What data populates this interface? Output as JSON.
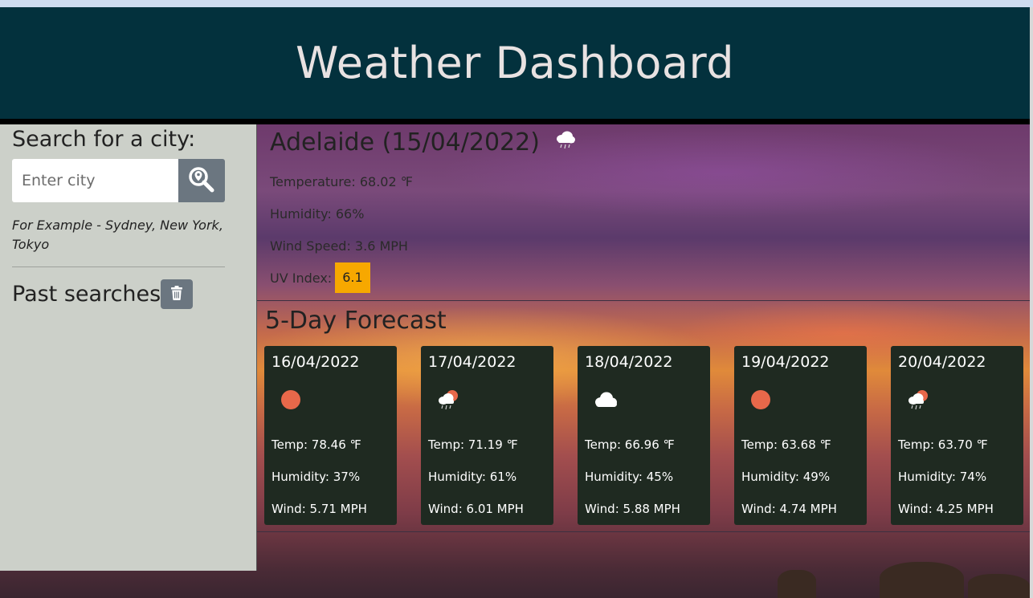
{
  "app": {
    "title": "Weather Dashboard"
  },
  "sidebar": {
    "search_title": "Search for a city:",
    "search_placeholder": "Enter city",
    "example_text": "For Example - Sydney, New York, Tokyo",
    "past_searches_title": "Past searches"
  },
  "current": {
    "title": "Adelaide (15/04/2022)",
    "icon": "rain-cloud-icon",
    "temperature": "Temperature: 68.02 ℉",
    "humidity": "Humidity: 66%",
    "wind": "Wind Speed: 3.6 MPH",
    "uv_label": "UV Index:",
    "uv_value": "6.1",
    "uv_color": "#f7a800"
  },
  "forecast": {
    "title": "5-Day Forecast",
    "days": [
      {
        "date": "16/04/2022",
        "icon": "sun-icon",
        "temp": "Temp: 78.46 ℉",
        "humidity": "Humidity: 37%",
        "wind": "Wind: 5.71 MPH"
      },
      {
        "date": "17/04/2022",
        "icon": "sun-rain-cloud-icon",
        "temp": "Temp: 71.19 ℉",
        "humidity": "Humidity: 61%",
        "wind": "Wind: 6.01 MPH"
      },
      {
        "date": "18/04/2022",
        "icon": "cloud-icon",
        "temp": "Temp: 66.96 ℉",
        "humidity": "Humidity: 45%",
        "wind": "Wind: 5.88 MPH"
      },
      {
        "date": "19/04/2022",
        "icon": "sun-icon",
        "temp": "Temp: 63.68 ℉",
        "humidity": "Humidity: 49%",
        "wind": "Wind: 4.74 MPH"
      },
      {
        "date": "20/04/2022",
        "icon": "sun-rain-cloud-icon",
        "temp": "Temp: 63.70 ℉",
        "humidity": "Humidity: 74%",
        "wind": "Wind: 4.25 MPH"
      }
    ]
  },
  "colors": {
    "header_bg": "#03313d",
    "sidebar_bg": "#ccd0c9",
    "card_bg": "#1f2a21",
    "button_bg": "#6b7680",
    "sun": "#e8684a"
  }
}
